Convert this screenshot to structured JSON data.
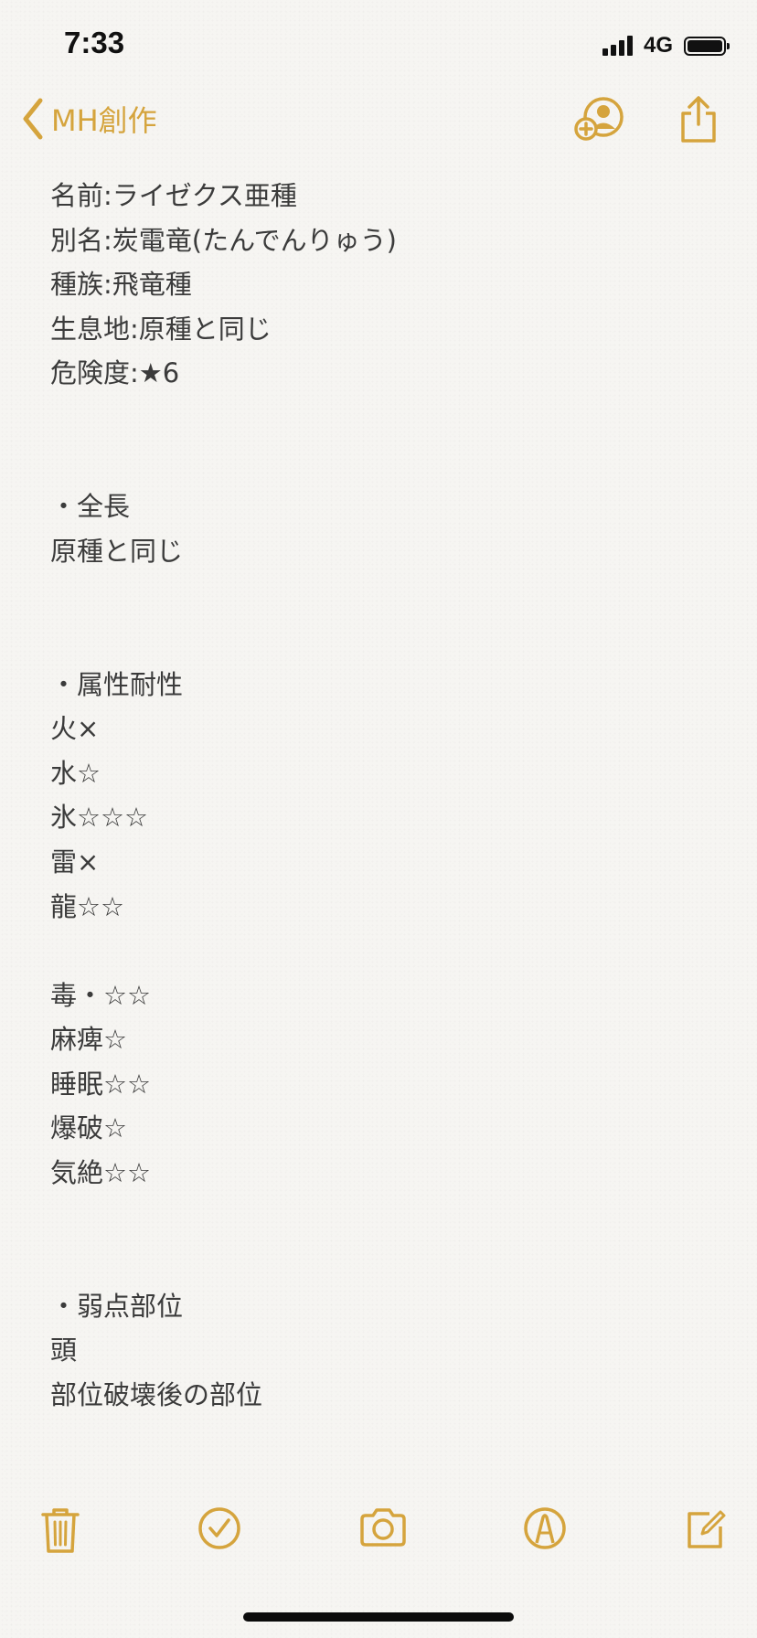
{
  "status_bar": {
    "time": "7:33",
    "network": "4G"
  },
  "nav": {
    "back_label": "MH創作",
    "accent_color": "#d5a43d"
  },
  "note": {
    "lines": [
      "名前:ライゼクス亜種",
      "別名:炭電竜(たんでんりゅう)",
      "種族:飛竜種",
      "生息地:原種と同じ",
      "危険度:★6",
      "",
      "",
      "・全長",
      "原種と同じ",
      "",
      "",
      "・属性耐性",
      "火×",
      "水☆",
      "氷☆☆☆",
      "雷×",
      "龍☆☆",
      "",
      "毒・☆☆",
      "麻痺☆",
      "睡眠☆☆",
      "爆破☆",
      "気絶☆☆",
      "",
      "",
      "・弱点部位",
      "頭",
      "部位破壊後の部位"
    ]
  },
  "icons": {
    "back": "chevron-left-icon",
    "share_person": "add-person-icon",
    "share": "share-icon",
    "trash": "trash-icon",
    "checklist": "checkmark-circle-icon",
    "camera": "camera-icon",
    "markup": "pen-tip-icon",
    "compose": "compose-icon"
  }
}
